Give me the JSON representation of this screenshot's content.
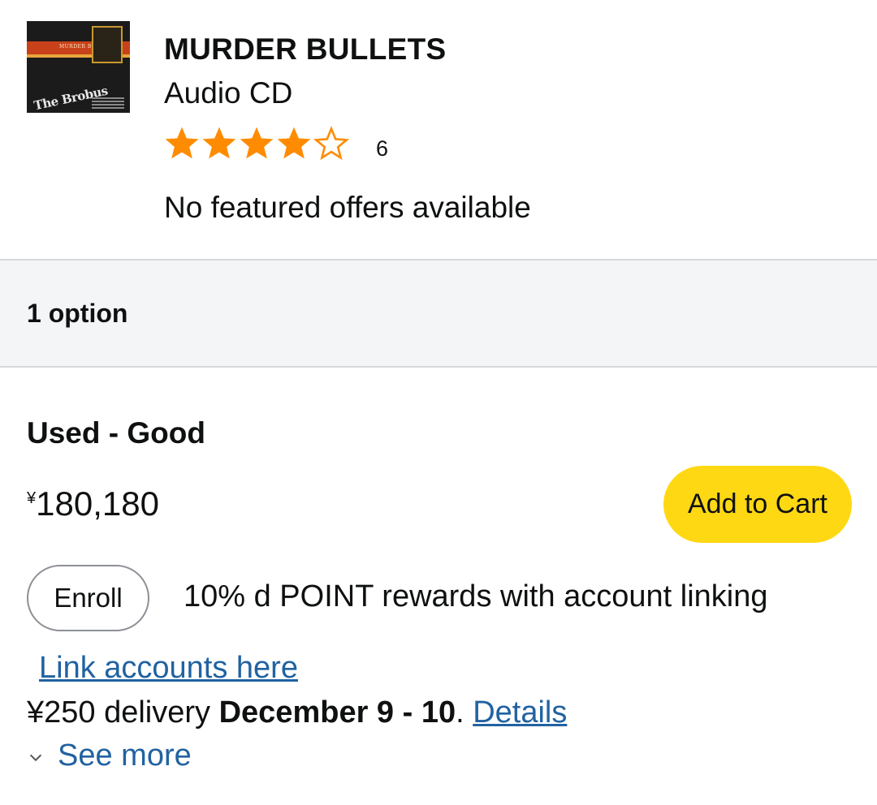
{
  "product": {
    "title": "MURDER BULLETS",
    "format": "Audio CD",
    "rating": 4.5,
    "rating_max": 5,
    "rating_count": "6",
    "availability": "No featured offers available",
    "thumbnail": {
      "band_text": "MURDER BULLETS",
      "logo_text": "The Brobus"
    }
  },
  "options": {
    "count_label": "1 option"
  },
  "offer": {
    "condition": "Used - Good",
    "price_symbol": "¥",
    "price_value": "180,180",
    "add_to_cart_label": "Add to Cart",
    "enroll_label": "Enroll",
    "rewards_text": "10% d POINT rewards with account linking",
    "link_accounts_label": "Link accounts here",
    "delivery_prefix": "¥250 delivery ",
    "delivery_dates": "December 9 - 10",
    "delivery_period": ". ",
    "details_label": "Details",
    "see_more_label": "See more"
  },
  "colors": {
    "star": "#ff8c00",
    "cart_button": "#ffd814",
    "link": "#2162a1",
    "option_bar": "#f3f5f7"
  },
  "icons": {
    "star_full": "star-filled-icon",
    "star_half": "star-half-icon",
    "star_empty": "star-outline-icon",
    "see_more": "chevron-down-icon"
  }
}
